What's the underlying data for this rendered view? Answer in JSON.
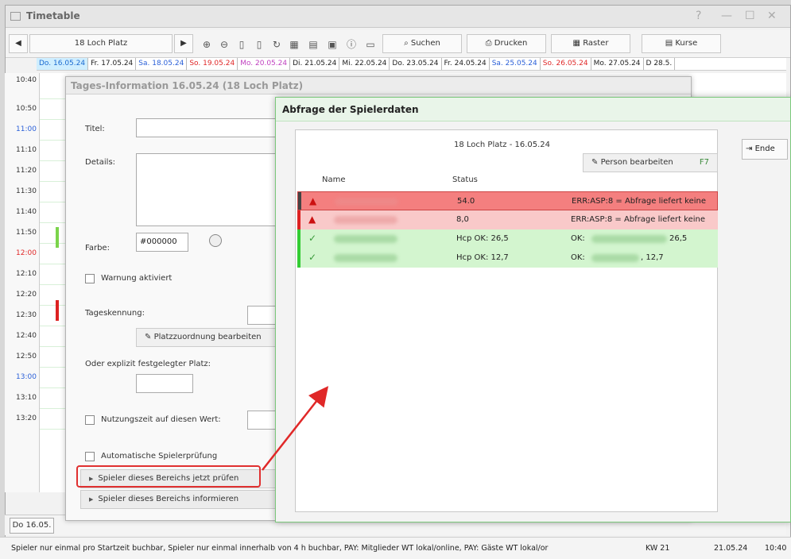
{
  "window": {
    "title": "Timetable"
  },
  "toolbar": {
    "location": "18 Loch Platz",
    "search_label": "Suchen",
    "print_label": "Drucken",
    "grid_label": "Raster",
    "courses_label": "Kurse"
  },
  "dates": [
    "Do. 16.05.24",
    "Fr. 17.05.24",
    "Sa. 18.05.24",
    "So. 19.05.24",
    "Mo. 20.05.24",
    "Di. 21.05.24",
    "Mi. 22.05.24",
    "Do. 23.05.24",
    "Fr. 24.05.24",
    "Sa. 25.05.24",
    "So. 26.05.24",
    "Mo. 27.05.24",
    "D 28.5."
  ],
  "times": [
    "10:40",
    "10:50",
    "11:00",
    "11:10",
    "11:20",
    "11:30",
    "11:40",
    "11:50",
    "12:00",
    "12:10",
    "12:20",
    "12:30",
    "12:40",
    "12:50",
    "13:00",
    "13:10",
    "13:20"
  ],
  "day_dialog": {
    "title": "Tages-Information 16.05.24 (18 Loch Platz)",
    "title_label": "Titel:",
    "details_label": "Details:",
    "color_label": "Farbe:",
    "color_value": "#000000",
    "warning_label": "Warnung aktiviert",
    "day_id_label": "Tageskennung:",
    "assign_button": "Platzzuordnung bearbeiten",
    "explicit_label": "Oder explizit festgelegter Platz:",
    "usage_label": "Nutzungszeit auf diesen Wert:",
    "auto_check_label": "Automatische Spielerprüfung",
    "check_now_button": "Spieler dieses Bereichs jetzt prüfen",
    "inform_button": "Spieler dieses Bereichs informieren"
  },
  "query_dialog": {
    "title": "Abfrage der Spielerdaten",
    "subtitle": "18 Loch Platz - 16.05.24",
    "edit_person_button": "Person bearbeiten",
    "edit_person_key": "F7",
    "end_button": "Ende",
    "col_name": "Name",
    "col_status": "Status",
    "rows": [
      {
        "state": "error",
        "status": "54.0",
        "message": "ERR:ASP:8 = Abfrage liefert keine"
      },
      {
        "state": "error",
        "status": "8,0",
        "message": "ERR:ASP:8 = Abfrage liefert keine"
      },
      {
        "state": "ok",
        "status": "Hcp OK: 26,5",
        "message": "OK:",
        "value": "26,5"
      },
      {
        "state": "ok",
        "status": "Hcp OK: 12,7",
        "message": "OK:",
        "value": ", 12,7"
      }
    ],
    "colors": {
      "error_selected": "#f47f7f",
      "error": "#f9c9c9",
      "ok": "#d3f5cf"
    }
  },
  "bottom": {
    "today_button": "Do 16.05.",
    "status_message": "Spieler nur einmal pro Startzeit buchbar, Spieler nur einmal innerhalb von 4 h buchbar, PAY: Mitglieder WT lokal/online, PAY: Gäste WT lokal/or",
    "week": "KW 21",
    "date": "21.05.24",
    "time": "10:40"
  }
}
